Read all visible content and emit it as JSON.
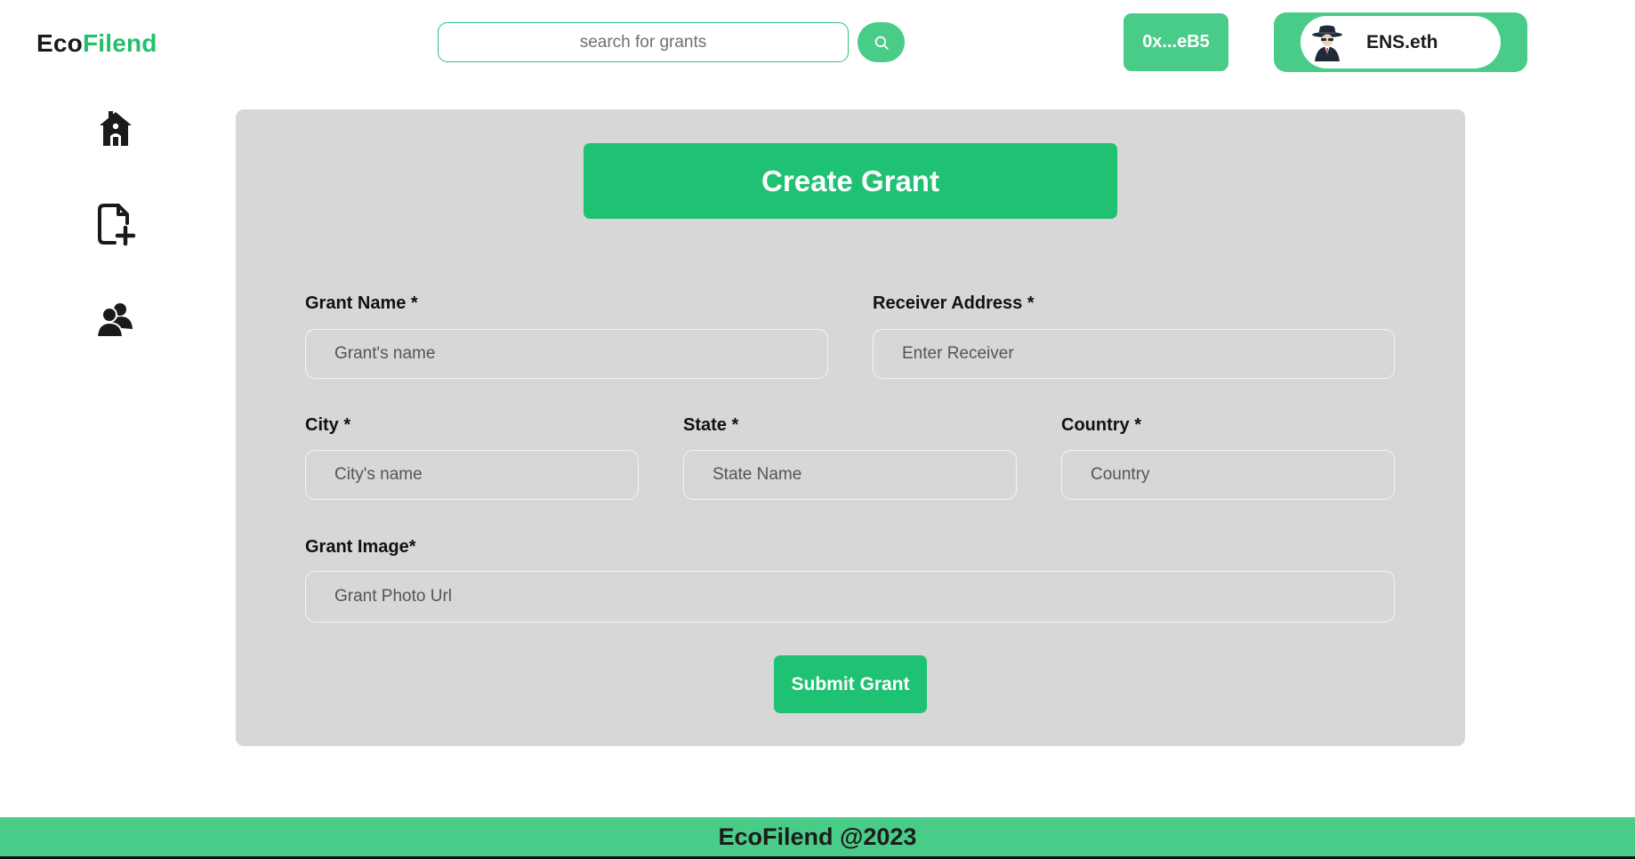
{
  "brand": {
    "part1": "Eco",
    "part2": "Filend"
  },
  "search": {
    "placeholder": "search for grants",
    "button_icon": "search-icon"
  },
  "wallet": {
    "address": "0x...eB5"
  },
  "ens": {
    "name": "ENS.eth",
    "avatar_icon": "spy-avatar-icon"
  },
  "sidebar": {
    "items": [
      {
        "icon": "home-icon"
      },
      {
        "icon": "file-plus-icon"
      },
      {
        "icon": "users-icon"
      }
    ]
  },
  "form": {
    "title": "Create Grant",
    "grant_name": {
      "label": "Grant Name *",
      "placeholder": "Grant's name"
    },
    "receiver": {
      "label": "Receiver Address *",
      "placeholder": "Enter Receiver"
    },
    "city": {
      "label": "City *",
      "placeholder": "City's name"
    },
    "state": {
      "label": "State *",
      "placeholder": "State Name"
    },
    "country": {
      "label": "Country *",
      "placeholder": "Country"
    },
    "image": {
      "label": "Grant Image*",
      "placeholder": "Grant Photo Url"
    },
    "submit_label": "Submit Grant"
  },
  "footer": {
    "text": "EcoFilend @2023"
  },
  "colors": {
    "accent": "#1fc172",
    "accent_light": "#49cc88",
    "panel": "#d7d7d7"
  }
}
